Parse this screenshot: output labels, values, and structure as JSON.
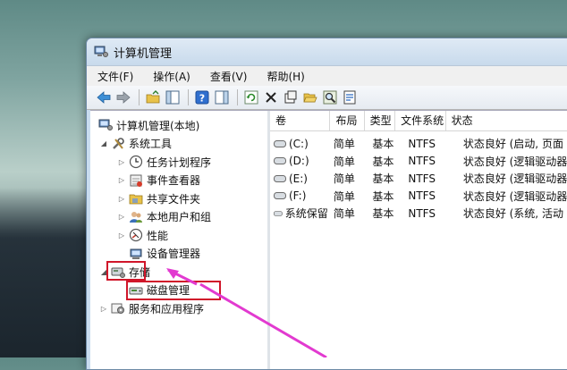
{
  "window": {
    "title": "计算机管理"
  },
  "menu": [
    {
      "label": "文件(F)"
    },
    {
      "label": "操作(A)"
    },
    {
      "label": "查看(V)"
    },
    {
      "label": "帮助(H)"
    }
  ],
  "tree": {
    "root": "计算机管理(本地)",
    "system_tools": "系统工具",
    "task_scheduler": "任务计划程序",
    "event_viewer": "事件查看器",
    "shared_folders": "共享文件夹",
    "local_users": "本地用户和组",
    "performance": "性能",
    "device_manager": "设备管理器",
    "storage": "存储",
    "disk_management": "磁盘管理",
    "services_apps": "服务和应用程序"
  },
  "table": {
    "headers": [
      "卷",
      "布局",
      "类型",
      "文件系统",
      "状态"
    ],
    "rows": [
      [
        "(C:)",
        "简单",
        "基本",
        "NTFS",
        "状态良好 (启动, 页面"
      ],
      [
        "(D:)",
        "简单",
        "基本",
        "NTFS",
        "状态良好 (逻辑驱动器"
      ],
      [
        "(E:)",
        "简单",
        "基本",
        "NTFS",
        "状态良好 (逻辑驱动器"
      ],
      [
        "(F:)",
        "简单",
        "基本",
        "NTFS",
        "状态良好 (逻辑驱动器"
      ],
      [
        "系统保留",
        "简单",
        "基本",
        "NTFS",
        "状态良好 (系统, 活动"
      ]
    ]
  },
  "colors": {
    "highlight": "#d0162a",
    "annotation_arrow": "#e23ad0"
  }
}
